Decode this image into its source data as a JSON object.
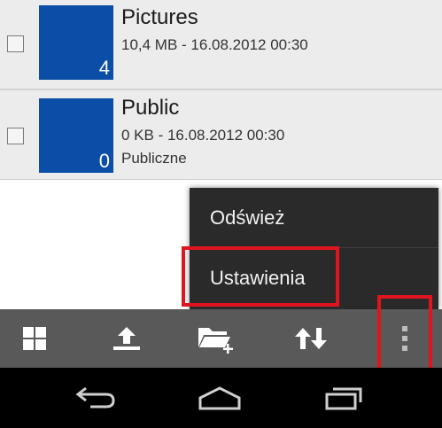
{
  "files": [
    {
      "name": "Pictures",
      "meta_line1": "10,4 MB - 16.08.2012 00:30",
      "meta_line2": "",
      "count": "4",
      "thumb_color": "#0a4ea8"
    },
    {
      "name": "Public",
      "meta_line1": "0 KB - 16.08.2012 00:30",
      "meta_line2": "Publiczne",
      "count": "0",
      "thumb_color": "#0a4ea8"
    }
  ],
  "overflow_menu": {
    "items": [
      {
        "label": "Odśwież"
      },
      {
        "label": "Ustawienia"
      }
    ],
    "highlight_color": "#e0141e"
  },
  "toolbar": {
    "icons": [
      "grid-view-icon",
      "upload-icon",
      "new-folder-icon",
      "sort-icon",
      "overflow-menu-icon"
    ]
  },
  "navbar": {
    "icons": [
      "back-icon",
      "home-icon",
      "recent-apps-icon"
    ]
  },
  "colors": {
    "thumbnail": "#0a4ea8",
    "toolbar_bg": "#595959",
    "menu_bg": "#2a2a2a",
    "highlight": "#e0141e"
  }
}
